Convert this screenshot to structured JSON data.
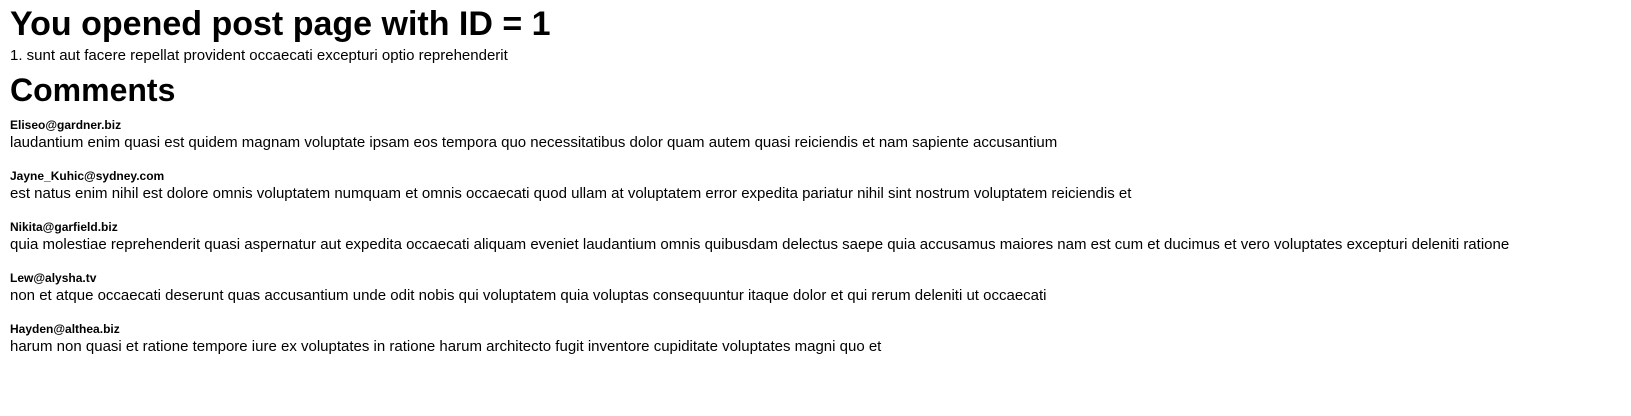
{
  "post": {
    "heading": "You opened post page with ID = 1",
    "title_line": "1. sunt aut facere repellat provident occaecati excepturi optio reprehenderit"
  },
  "comments": {
    "heading": "Comments",
    "items": [
      {
        "email": "Eliseo@gardner.biz",
        "body": "laudantium enim quasi est quidem magnam voluptate ipsam eos tempora quo necessitatibus dolor quam autem quasi reiciendis et nam sapiente accusantium"
      },
      {
        "email": "Jayne_Kuhic@sydney.com",
        "body": "est natus enim nihil est dolore omnis voluptatem numquam et omnis occaecati quod ullam at voluptatem error expedita pariatur nihil sint nostrum voluptatem reiciendis et"
      },
      {
        "email": "Nikita@garfield.biz",
        "body": "quia molestiae reprehenderit quasi aspernatur aut expedita occaecati aliquam eveniet laudantium omnis quibusdam delectus saepe quia accusamus maiores nam est cum et ducimus et vero voluptates excepturi deleniti ratione"
      },
      {
        "email": "Lew@alysha.tv",
        "body": "non et atque occaecati deserunt quas accusantium unde odit nobis qui voluptatem quia voluptas consequuntur itaque dolor et qui rerum deleniti ut occaecati"
      },
      {
        "email": "Hayden@althea.biz",
        "body": "harum non quasi et ratione tempore iure ex voluptates in ratione harum architecto fugit inventore cupiditate voluptates magni quo et"
      }
    ]
  }
}
